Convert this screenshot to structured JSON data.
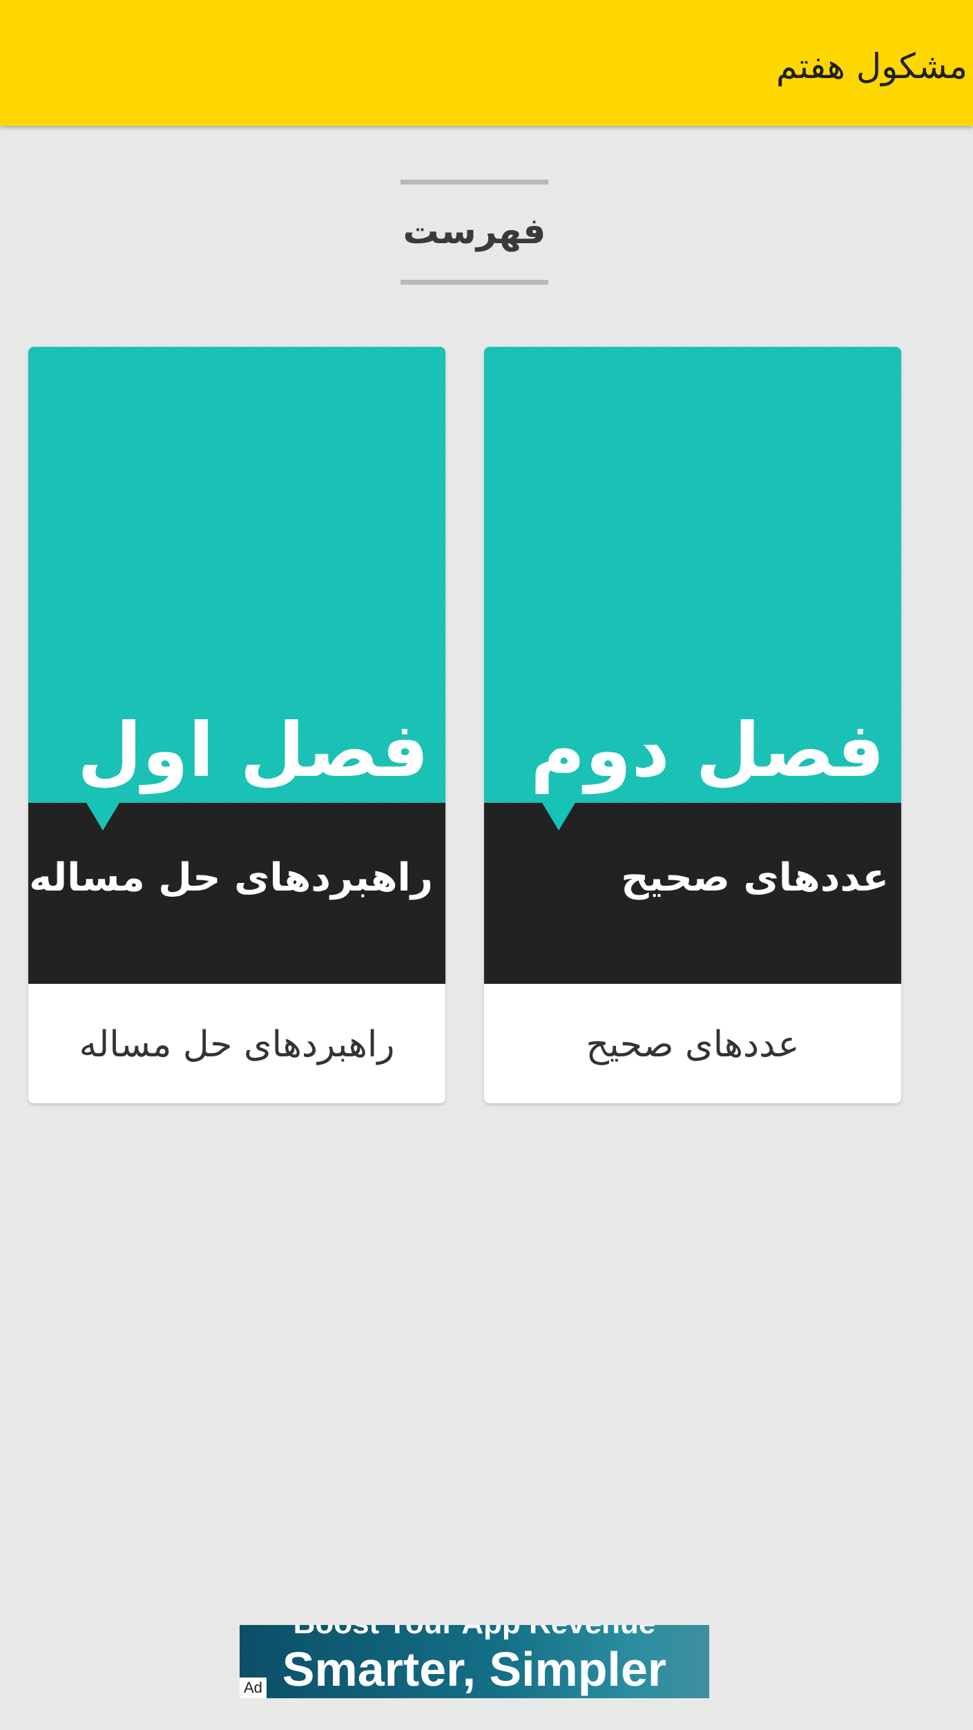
{
  "header": {
    "title": "مشکول هفتم"
  },
  "section": {
    "heading": "فهرست"
  },
  "cards": [
    {
      "chapter": "فصل اول",
      "subtitle": "راهبردهای حل مساله",
      "caption": "راهبردهای حل مساله"
    },
    {
      "chapter": "فصل دوم",
      "subtitle": "عددهای صحیح",
      "caption": "عددهای صحیح"
    }
  ],
  "ad": {
    "line1": "Boost Your App Revenue",
    "line2": "Smarter, Simpler",
    "badge": "Ad"
  },
  "colors": {
    "appbar": "#ffd700",
    "card_cover": "#17c3b6",
    "card_band": "#222222",
    "background": "#e8e8e9"
  }
}
